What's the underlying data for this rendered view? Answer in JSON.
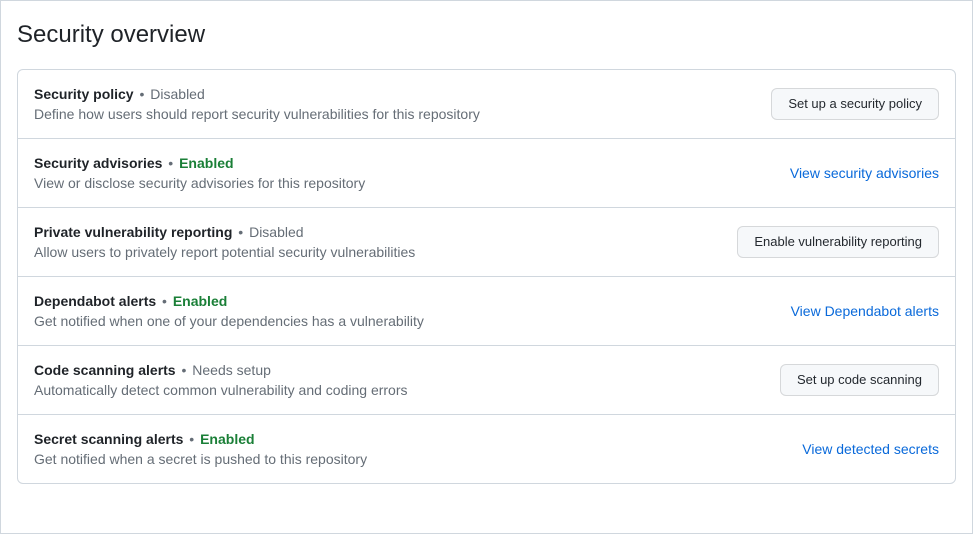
{
  "page_title": "Security overview",
  "separator": "•",
  "items": [
    {
      "title": "Security policy",
      "status_text": "Disabled",
      "status_class": "status-disabled",
      "description": "Define how users should report security vulnerabilities for this repository",
      "action_type": "button",
      "action_label": "Set up a security policy",
      "row_name": "security-policy-row",
      "action_name": "setup-security-policy-button"
    },
    {
      "title": "Security advisories",
      "status_text": "Enabled",
      "status_class": "status-enabled",
      "description": "View or disclose security advisories for this repository",
      "action_type": "link",
      "action_label": "View security advisories",
      "row_name": "security-advisories-row",
      "action_name": "view-security-advisories-link"
    },
    {
      "title": "Private vulnerability reporting",
      "status_text": "Disabled",
      "status_class": "status-disabled",
      "description": "Allow users to privately report potential security vulnerabilities",
      "action_type": "button",
      "action_label": "Enable vulnerability reporting",
      "row_name": "private-vulnerability-reporting-row",
      "action_name": "enable-vulnerability-reporting-button"
    },
    {
      "title": "Dependabot alerts",
      "status_text": "Enabled",
      "status_class": "status-enabled",
      "description": "Get notified when one of your dependencies has a vulnerability",
      "action_type": "link",
      "action_label": "View Dependabot alerts",
      "row_name": "dependabot-alerts-row",
      "action_name": "view-dependabot-alerts-link"
    },
    {
      "title": "Code scanning alerts",
      "status_text": "Needs setup",
      "status_class": "status-needs-setup",
      "description": "Automatically detect common vulnerability and coding errors",
      "action_type": "button",
      "action_label": "Set up code scanning",
      "row_name": "code-scanning-alerts-row",
      "action_name": "setup-code-scanning-button"
    },
    {
      "title": "Secret scanning alerts",
      "status_text": "Enabled",
      "status_class": "status-enabled",
      "description": "Get notified when a secret is pushed to this repository",
      "action_type": "link",
      "action_label": "View detected secrets",
      "row_name": "secret-scanning-alerts-row",
      "action_name": "view-detected-secrets-link"
    }
  ]
}
